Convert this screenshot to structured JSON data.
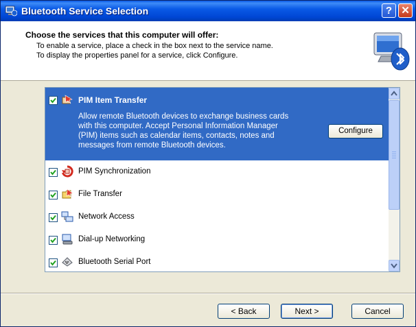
{
  "window": {
    "title": "Bluetooth Service Selection",
    "help_label": "?",
    "close_label": "✕"
  },
  "header": {
    "heading": "Choose the services that this computer will offer:",
    "line1": "To enable a service, place a check in the box next to the service name.",
    "line2": "To display the properties panel for a service, click Configure."
  },
  "services": [
    {
      "label": "PIM Item Transfer",
      "checked": true,
      "selected": true,
      "icon": "pim-transfer-icon",
      "description": [
        "Allow remote Bluetooth devices to exchange business cards",
        "with this computer. Accept Personal Information Manager",
        "(PIM) items such as calendar items, contacts, notes and",
        "messages from remote Bluetooth devices."
      ],
      "configure_label": "Configure"
    },
    {
      "label": "PIM Synchronization",
      "checked": true,
      "icon": "pim-sync-icon"
    },
    {
      "label": "File Transfer",
      "checked": true,
      "icon": "file-transfer-icon"
    },
    {
      "label": "Network Access",
      "checked": true,
      "icon": "network-access-icon"
    },
    {
      "label": "Dial-up Networking",
      "checked": true,
      "icon": "dialup-networking-icon"
    },
    {
      "label": "Bluetooth Serial Port",
      "checked": true,
      "icon": "serial-port-icon"
    }
  ],
  "footer": {
    "back_label": "< Back",
    "next_label": "Next >",
    "cancel_label": "Cancel"
  },
  "colors": {
    "selection": "#316ac5",
    "titlebar": "#0a5ae6",
    "dialog_bg": "#ece9d8"
  }
}
